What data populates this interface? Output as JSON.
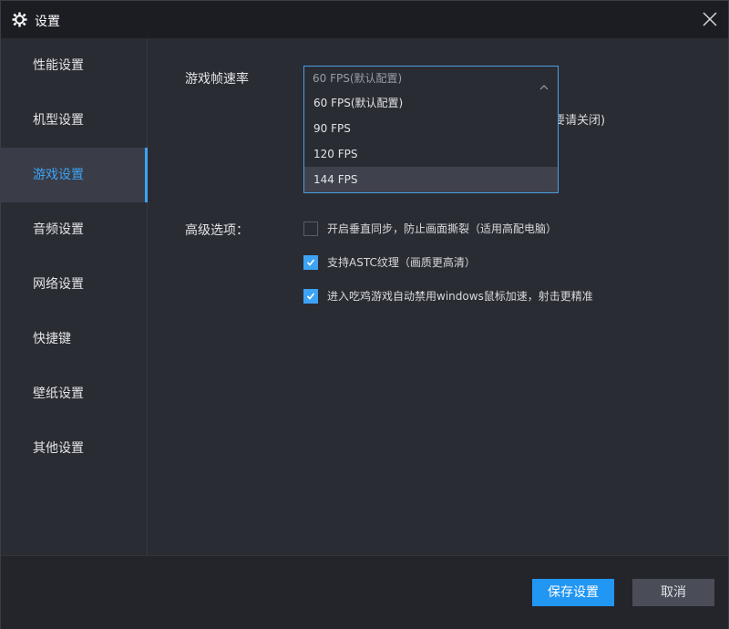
{
  "window": {
    "title": "设置"
  },
  "sidebar": {
    "items": [
      {
        "label": "性能设置",
        "active": false
      },
      {
        "label": "机型设置",
        "active": false
      },
      {
        "label": "游戏设置",
        "active": true
      },
      {
        "label": "音频设置",
        "active": false
      },
      {
        "label": "网络设置",
        "active": false
      },
      {
        "label": "快捷键",
        "active": false
      },
      {
        "label": "壁纸设置",
        "active": false
      },
      {
        "label": "其他设置",
        "active": false
      }
    ]
  },
  "game": {
    "fps_label": "游戏帧速率",
    "fps_selected": "60 FPS(默认配置)",
    "fps_options": [
      "60 FPS(默认配置)",
      "90 FPS",
      "120 FPS",
      "144 FPS"
    ],
    "fps_hovered_option": "144 FPS",
    "partially_hidden_text": "要请关闭)",
    "advanced_label": "高级选项：",
    "options": [
      {
        "label": "开启垂直同步，防止画面撕裂（适用高配电脑）",
        "checked": false
      },
      {
        "label": "支持ASTC纹理（画质更高清）",
        "checked": true
      },
      {
        "label": "进入吃鸡游戏自动禁用windows鼠标加速，射击更精准",
        "checked": true
      }
    ]
  },
  "footer": {
    "save_label": "保存设置",
    "cancel_label": "取消"
  },
  "colors": {
    "accent": "#3ea3f5",
    "primary_button": "#2196f3",
    "background": "#2a2c34",
    "titlebar": "#1c1d22"
  },
  "icons": {
    "title": "gear-icon",
    "close": "close-icon",
    "dropdown": "chevron-up-icon",
    "check": "check-icon"
  }
}
